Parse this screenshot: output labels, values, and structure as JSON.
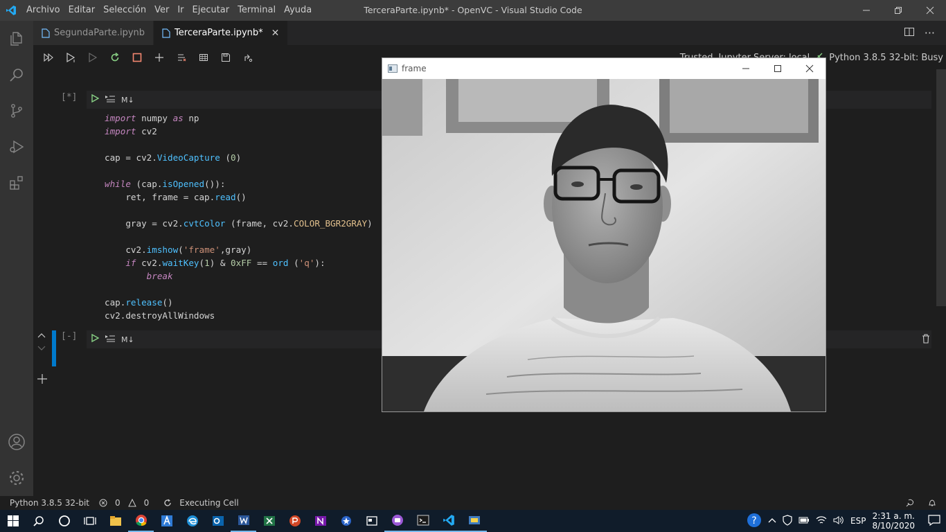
{
  "titlebar": {
    "menu": [
      "Archivo",
      "Editar",
      "Selección",
      "Ver",
      "Ir",
      "Ejecutar",
      "Terminal",
      "Ayuda"
    ],
    "title": "TerceraParte.ipynb* - OpenVC - Visual Studio Code"
  },
  "tabs": [
    {
      "label": "SegundaParte.ipynb"
    },
    {
      "label": "TerceraParte.ipynb*"
    }
  ],
  "toolbar": {
    "trusted": "Trusted",
    "server": "Jupyter Server: local",
    "kernel": "Python 3.8.5 32-bit: Busy"
  },
  "cells": [
    {
      "exec_count": "[*]",
      "type": "M↓"
    },
    {
      "exec_count": "[-]",
      "type": "M↓"
    }
  ],
  "frame_window": {
    "title": "frame"
  },
  "statusbar": {
    "interpreter": "Python 3.8.5 32-bit",
    "errors": "0",
    "warnings": "0",
    "status": "Executing Cell"
  },
  "taskbar": {
    "language": "ESP",
    "time": "2:31 a. m.",
    "date": "8/10/2020"
  }
}
